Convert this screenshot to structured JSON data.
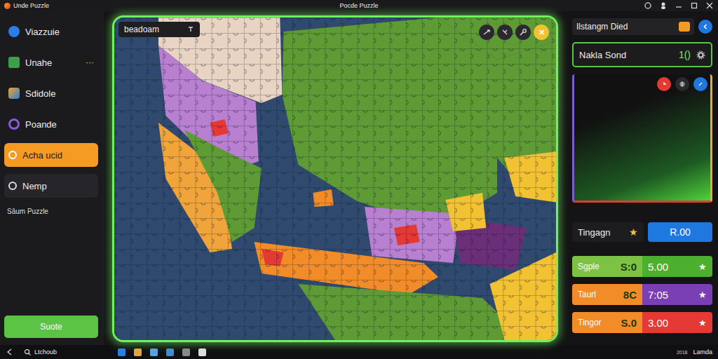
{
  "window": {
    "app_name": "Unde Puzzle",
    "title": "Pocde Puzzle"
  },
  "sidebar": {
    "items": [
      {
        "label": "Viazzuie",
        "selected": false,
        "more": ""
      },
      {
        "label": "Unahe",
        "selected": false,
        "more": "···"
      },
      {
        "label": "Sdidole",
        "selected": false,
        "more": ""
      },
      {
        "label": "Poande",
        "selected": false,
        "more": ""
      },
      {
        "label": "Acha ucid",
        "selected": true,
        "more": ""
      },
      {
        "label": "Nemp",
        "selected": false,
        "more": ""
      }
    ],
    "section_label": "Sâum Puzzle",
    "button": "Suote"
  },
  "board": {
    "label": "beadoam",
    "close": "✕"
  },
  "panel": {
    "header": "Ilstangm Died",
    "field": {
      "label": "Nakla Sond",
      "value": "1()"
    },
    "rating": {
      "label": "Tingagn",
      "star": "★",
      "button": "R.00"
    },
    "scores": [
      {
        "name": "Sgple",
        "score": "S:0",
        "time": "5.00",
        "star": "★",
        "color": "#7dc242",
        "accent": "#4caf2e"
      },
      {
        "name": "Taurl",
        "score": "8C",
        "time": "7:05",
        "star": "★",
        "color": "#f28c28",
        "accent": "#7b3fb5"
      },
      {
        "name": "Tingor",
        "score": "S.0",
        "time": "3.00",
        "star": "★",
        "color": "#f28c28",
        "accent": "#e53935"
      }
    ]
  },
  "taskbar": {
    "search": "Ltchoub",
    "tray_text": "Lamda",
    "tray_date": "2018"
  }
}
